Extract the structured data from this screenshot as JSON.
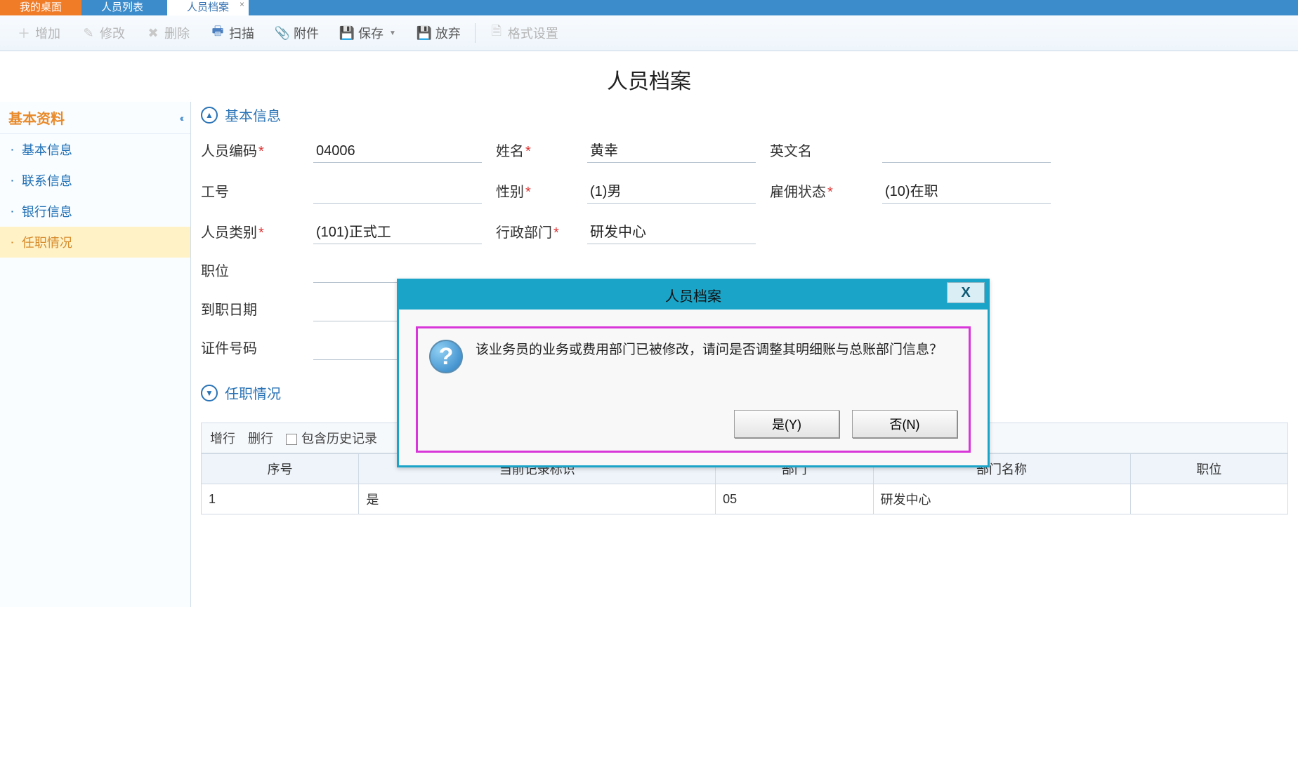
{
  "tabs": {
    "t1": "我的桌面",
    "t2": "人员列表",
    "t3": "人员档案"
  },
  "toolbar": {
    "add": "增加",
    "edit": "修改",
    "delete": "删除",
    "scan": "扫描",
    "attach": "附件",
    "save": "保存",
    "discard": "放弃",
    "format": "格式设置"
  },
  "page_title": "人员档案",
  "sidebar": {
    "title": "基本资料",
    "items": [
      "基本信息",
      "联系信息",
      "银行信息",
      "任职情况"
    ]
  },
  "sections": {
    "basic": "基本信息",
    "job": "任职情况"
  },
  "form": {
    "labels": {
      "code": "人员编码",
      "name": "姓名",
      "enname": "英文名",
      "workno": "工号",
      "gender": "性别",
      "employ": "雇佣状态",
      "ptype": "人员类别",
      "dept": "行政部门",
      "position": "职位",
      "hiredate": "到职日期",
      "idno": "证件号码"
    },
    "values": {
      "code": "04006",
      "name": "黄幸",
      "enname": "",
      "workno": "",
      "gender": "(1)男",
      "employ": "(10)在职",
      "ptype": "(101)正式工",
      "dept": "研发中心",
      "position": "",
      "hiredate": "",
      "idno": ""
    }
  },
  "subtoolbar": {
    "addrow": "增行",
    "delrow": "删行",
    "history": "包含历史记录"
  },
  "table": {
    "headers": [
      "序号",
      "当前记录标识",
      "部门",
      "部门名称",
      "职位"
    ],
    "row": {
      "seq": "1",
      "flag": "是",
      "dept": "05",
      "deptname": "研发中心",
      "pos": ""
    }
  },
  "dialog": {
    "title": "人员档案",
    "message": "该业务员的业务或费用部门已被修改，请问是否调整其明细账与总账部门信息？",
    "yes": "是(Y)",
    "no": "否(N)",
    "close": "X"
  }
}
